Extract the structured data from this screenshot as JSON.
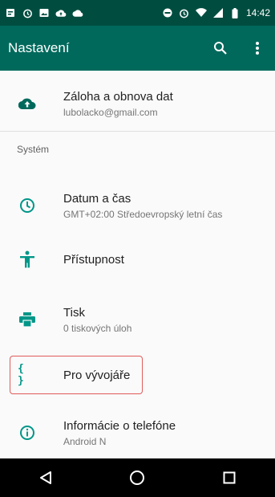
{
  "status_bar": {
    "time": "14:42",
    "left_icons": [
      "notification-icon",
      "alarm-icon",
      "image-icon",
      "cloud-icon",
      "cloud-icon"
    ],
    "right_icons": [
      "do-not-disturb-icon",
      "alarm-icon",
      "wifi-icon",
      "signal-icon",
      "battery-icon"
    ]
  },
  "app_bar": {
    "title": "Nastavení",
    "search_icon": "search-icon",
    "more_icon": "more-vert-icon"
  },
  "items": {
    "backup": {
      "title": "Záloha a obnova dat",
      "subtitle": "lubolacko@gmail.com",
      "icon": "cloud-upload-icon"
    },
    "section_system": "Systém",
    "datetime": {
      "title": "Datum a čas",
      "subtitle": "GMT+02:00 Středoevropský letní čas",
      "icon": "clock-icon"
    },
    "accessibility": {
      "title": "Přístupnost",
      "icon": "accessibility-icon"
    },
    "print": {
      "title": "Tisk",
      "subtitle": "0 tiskových úloh",
      "icon": "printer-icon"
    },
    "developer": {
      "title": "Pro vývojáře",
      "icon": "braces-icon",
      "icon_text": "{ }"
    },
    "about": {
      "title": "Informácie o telefóne",
      "subtitle": "Android N",
      "icon": "info-icon"
    }
  },
  "nav_bar": {
    "back": "back-icon",
    "home": "home-icon",
    "recents": "recents-icon"
  },
  "colors": {
    "accent": "#009688",
    "status_bar": "#004d40",
    "app_bar": "#00695c",
    "highlight": "#e05a5a"
  }
}
